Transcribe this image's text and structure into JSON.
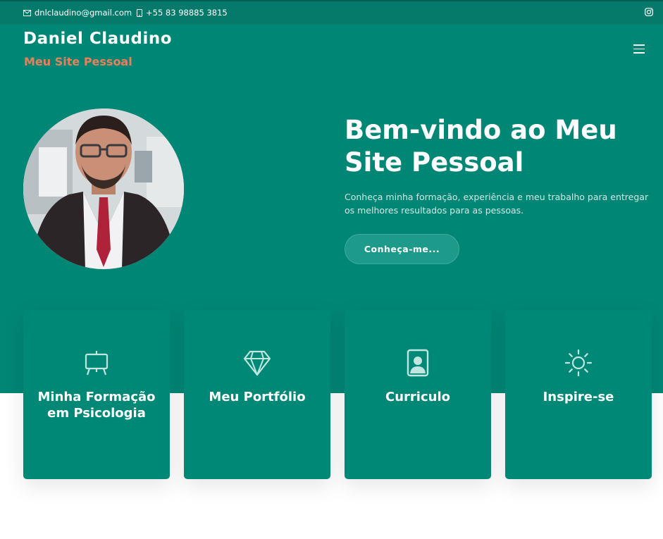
{
  "topbar": {
    "email": "dnlclaudino@gmail.com",
    "phone": "+55 83 98885 3815",
    "email_icon": "envelope-icon",
    "phone_icon": "phone-icon",
    "social_icon": "instagram-icon"
  },
  "header": {
    "name": "Daniel Claudino",
    "subtitle": "Meu Site Pessoal",
    "menu_icon": "hamburger-icon"
  },
  "hero": {
    "title": "Bem-vindo ao Meu Site Pessoal",
    "text": "Conheça minha formação, experiência e meu trabalho para entregar os melhores resultados para as pessoas.",
    "button": "Conheça-me..."
  },
  "cards": [
    {
      "label": "Minha Formação em Psicologia",
      "icon": "presentation-board-icon"
    },
    {
      "label": "Meu Portfólio",
      "icon": "diamond-icon"
    },
    {
      "label": "Curriculo",
      "icon": "person-badge-icon"
    },
    {
      "label": "Inspire-se",
      "icon": "sun-icon"
    }
  ],
  "colors": {
    "primary": "#008675",
    "topbar": "#057a6b",
    "accent": "#e7815c",
    "card": "#008877"
  }
}
